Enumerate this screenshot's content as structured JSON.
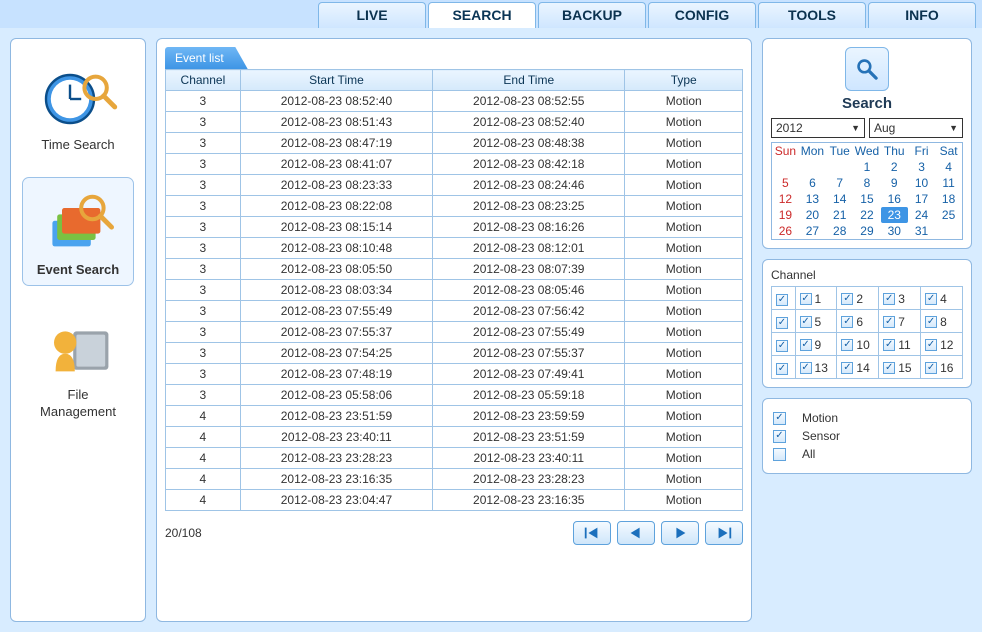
{
  "tabs": {
    "live": "LIVE",
    "search": "SEARCH",
    "backup": "BACKUP",
    "config": "CONFIG",
    "tools": "TOOLS",
    "info": "INFO"
  },
  "sidebar": {
    "time_search": "Time Search",
    "event_search": "Event Search",
    "file_management": "File\nManagement"
  },
  "events": {
    "title": "Event list",
    "cols": {
      "channel": "Channel",
      "start": "Start Time",
      "end": "End Time",
      "type": "Type"
    },
    "rows": [
      {
        "ch": "3",
        "start": "2012-08-23 08:52:40",
        "end": "2012-08-23 08:52:55",
        "type": "Motion"
      },
      {
        "ch": "3",
        "start": "2012-08-23 08:51:43",
        "end": "2012-08-23 08:52:40",
        "type": "Motion"
      },
      {
        "ch": "3",
        "start": "2012-08-23 08:47:19",
        "end": "2012-08-23 08:48:38",
        "type": "Motion"
      },
      {
        "ch": "3",
        "start": "2012-08-23 08:41:07",
        "end": "2012-08-23 08:42:18",
        "type": "Motion"
      },
      {
        "ch": "3",
        "start": "2012-08-23 08:23:33",
        "end": "2012-08-23 08:24:46",
        "type": "Motion"
      },
      {
        "ch": "3",
        "start": "2012-08-23 08:22:08",
        "end": "2012-08-23 08:23:25",
        "type": "Motion"
      },
      {
        "ch": "3",
        "start": "2012-08-23 08:15:14",
        "end": "2012-08-23 08:16:26",
        "type": "Motion"
      },
      {
        "ch": "3",
        "start": "2012-08-23 08:10:48",
        "end": "2012-08-23 08:12:01",
        "type": "Motion"
      },
      {
        "ch": "3",
        "start": "2012-08-23 08:05:50",
        "end": "2012-08-23 08:07:39",
        "type": "Motion"
      },
      {
        "ch": "3",
        "start": "2012-08-23 08:03:34",
        "end": "2012-08-23 08:05:46",
        "type": "Motion"
      },
      {
        "ch": "3",
        "start": "2012-08-23 07:55:49",
        "end": "2012-08-23 07:56:42",
        "type": "Motion"
      },
      {
        "ch": "3",
        "start": "2012-08-23 07:55:37",
        "end": "2012-08-23 07:55:49",
        "type": "Motion"
      },
      {
        "ch": "3",
        "start": "2012-08-23 07:54:25",
        "end": "2012-08-23 07:55:37",
        "type": "Motion"
      },
      {
        "ch": "3",
        "start": "2012-08-23 07:48:19",
        "end": "2012-08-23 07:49:41",
        "type": "Motion"
      },
      {
        "ch": "3",
        "start": "2012-08-23 05:58:06",
        "end": "2012-08-23 05:59:18",
        "type": "Motion"
      },
      {
        "ch": "4",
        "start": "2012-08-23 23:51:59",
        "end": "2012-08-23 23:59:59",
        "type": "Motion"
      },
      {
        "ch": "4",
        "start": "2012-08-23 23:40:11",
        "end": "2012-08-23 23:51:59",
        "type": "Motion"
      },
      {
        "ch": "4",
        "start": "2012-08-23 23:28:23",
        "end": "2012-08-23 23:40:11",
        "type": "Motion"
      },
      {
        "ch": "4",
        "start": "2012-08-23 23:16:35",
        "end": "2012-08-23 23:28:23",
        "type": "Motion"
      },
      {
        "ch": "4",
        "start": "2012-08-23 23:04:47",
        "end": "2012-08-23 23:16:35",
        "type": "Motion"
      }
    ],
    "page": "20/108"
  },
  "search": {
    "label": "Search",
    "year": "2012",
    "month": "Aug",
    "dow": [
      "Sun",
      "Mon",
      "Tue",
      "Wed",
      "Thu",
      "Fri",
      "Sat"
    ],
    "weeks": [
      [
        "",
        "",
        "",
        "1",
        "2",
        "3",
        "4"
      ],
      [
        "5",
        "6",
        "7",
        "8",
        "9",
        "10",
        "11"
      ],
      [
        "12",
        "13",
        "14",
        "15",
        "16",
        "17",
        "18"
      ],
      [
        "19",
        "20",
        "21",
        "22",
        "23",
        "24",
        "25"
      ],
      [
        "26",
        "27",
        "28",
        "29",
        "30",
        "31",
        ""
      ]
    ],
    "selected_day": "23"
  },
  "channels": {
    "label": "Channel",
    "items": [
      "1",
      "2",
      "3",
      "4",
      "5",
      "6",
      "7",
      "8",
      "9",
      "10",
      "11",
      "12",
      "13",
      "14",
      "15",
      "16"
    ]
  },
  "filters": {
    "motion": {
      "label": "Motion",
      "checked": true
    },
    "sensor": {
      "label": "Sensor",
      "checked": true
    },
    "all": {
      "label": "All",
      "checked": false
    }
  }
}
